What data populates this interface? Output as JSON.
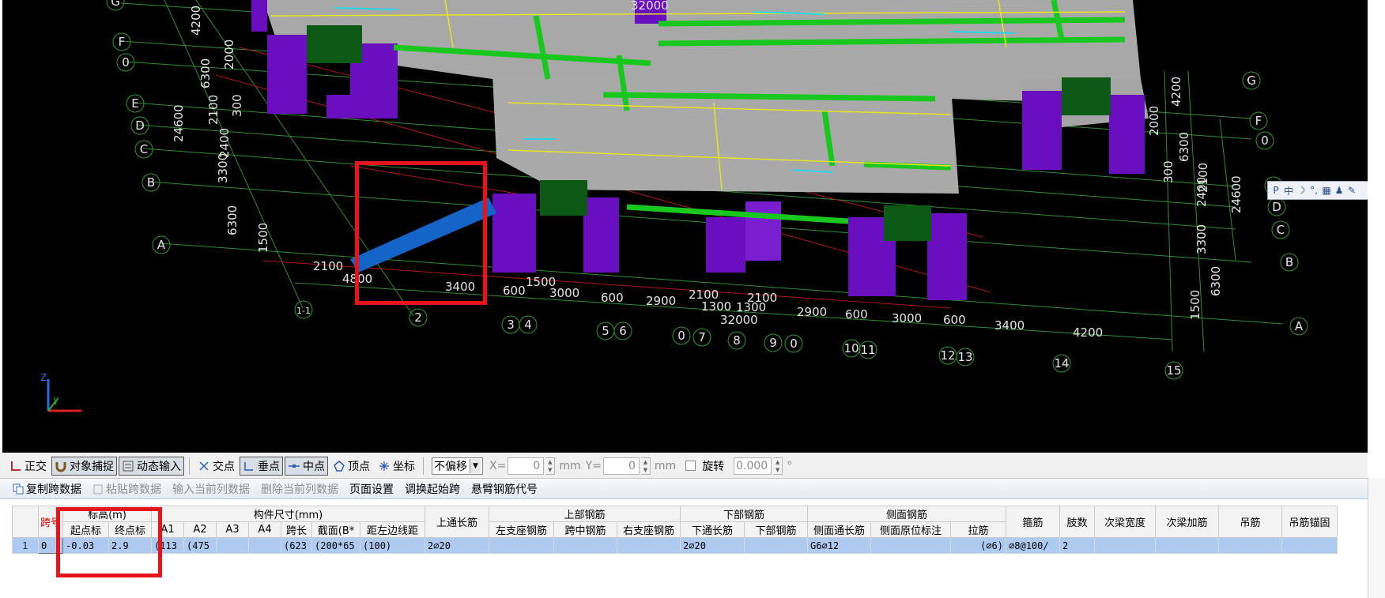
{
  "viewport": {
    "grid_letters_left": [
      "G",
      "F",
      "0",
      "E",
      "D",
      "C",
      "B",
      "A"
    ],
    "grid_letters_right": [
      "G",
      "F",
      "0",
      "E",
      "D",
      "C",
      "B",
      "A"
    ],
    "grid_numbers_bottom": [
      "1-1",
      "2",
      "3",
      "4",
      "5",
      "6",
      "0",
      "7",
      "8",
      "9",
      "0",
      "10",
      "11",
      "12",
      "13",
      "14",
      "15"
    ],
    "dims_left": [
      "4200",
      "6300",
      "2000",
      "24600",
      "2100",
      "300",
      "2400",
      "3300",
      "6300",
      "1500"
    ],
    "dims_right": [
      "4200",
      "2000",
      "6300",
      "300",
      "24600",
      "2100",
      "2400",
      "3300",
      "6300",
      "1500"
    ],
    "dims_bottom": [
      "2100",
      "4800",
      "3400",
      "600",
      "1500",
      "3000",
      "600",
      "2900",
      "2100",
      "1300",
      "1300",
      "2100",
      "32000",
      "2900",
      "600",
      "3000",
      "600",
      "3400",
      "4200"
    ],
    "dim_top": "32000",
    "axis_z": "Z",
    "axis_y": "Y",
    "ime": [
      "P",
      "中",
      "☽",
      "°,",
      "▦",
      "♟",
      "✎"
    ]
  },
  "snapbar": {
    "ortho": "正交",
    "object_snap": "对象捕捉",
    "dynamic_input": "动态输入",
    "intersection": "交点",
    "perpendicular": "垂点",
    "midpoint": "中点",
    "vertex": "顶点",
    "coordinate": "坐标",
    "offset_mode": "不偏移",
    "x_label": "X=",
    "x_value": "0",
    "mm1": "mm",
    "y_label": "Y=",
    "y_value": "0",
    "mm2": "mm",
    "rotate_label": "旋转",
    "rotate_value": "0.000",
    "degree": "°"
  },
  "gridtools": {
    "copy_span": "复制跨数据",
    "paste_span": "粘贴跨数据",
    "input_col": "输入当前列数据",
    "delete_col": "删除当前列数据",
    "page_setup": "页面设置",
    "adjust_start": "调换起始跨",
    "cantilever": "悬臂钢筋代号"
  },
  "grid": {
    "group_headers": {
      "span": "跨号",
      "elevation": "标高(m)",
      "dimensions": "构件尺寸(mm)",
      "top_through": "上通长筋",
      "top_bar": "上部钢筋",
      "bottom_bar": "下部钢筋",
      "side_bar": "侧面钢筋",
      "stirrup": "箍筋",
      "legs": "肢数",
      "sec_width": "次梁宽度",
      "sec_add": "次梁加筋",
      "hanger": "吊筋",
      "hanger_anchor": "吊筋锚固"
    },
    "sub_headers": {
      "start_elev": "起点标",
      "end_elev": "终点标",
      "a1": "A1",
      "a2": "A2",
      "a3": "A3",
      "a4": "A4",
      "span_len": "跨长",
      "section": "截面(B*",
      "edge_dist": "距左边线距",
      "left_seat": "左支座钢筋",
      "mid_span": "跨中钢筋",
      "right_seat": "右支座钢筋",
      "bottom_through": "下通长筋",
      "bottom_rebar": "下部钢筋",
      "side_through": "侧面通长筋",
      "side_orig": "侧面原位标注",
      "tie": "拉筋"
    },
    "row": {
      "row_no": "1",
      "span": "0",
      "start_elev": "-0.03",
      "end_elev": "2.9",
      "a1": "(113",
      "a2": "(475",
      "a3": "",
      "a4": "",
      "span_len": "(623",
      "section": "(200*65",
      "edge_dist": "(100)",
      "top_through": "2⌀20",
      "left_seat": "",
      "mid_span": "",
      "right_seat": "",
      "bottom_through": "2⌀20",
      "bottom_rebar": "",
      "side_through": "G6⌀12",
      "side_orig": "",
      "tie": "(⌀6)",
      "stirrup": "⌀8@100/",
      "legs": "2",
      "sec_width": "",
      "sec_add": "",
      "hanger": "",
      "hanger_anchor": ""
    }
  }
}
